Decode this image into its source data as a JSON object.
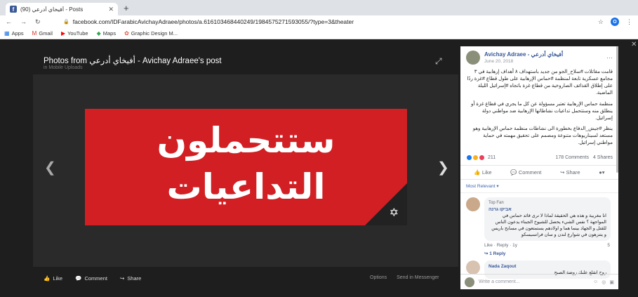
{
  "browser": {
    "tab_title": "(90) أفيخاي أدرعي - Posts",
    "tab_prefix": "...aee",
    "url": "facebook.com/IDFarabicAvichayAdraee/photos/a.616103468440249/1984575271593055/?type=3&theater",
    "bookmarks": [
      "Apps",
      "Gmail",
      "YouTube",
      "Maps",
      "Graphic Design M..."
    ],
    "profile_initial": "O"
  },
  "photo": {
    "title": "Photos from أفيخاي أدرعي - Avichay Adraee's post",
    "subtitle": "in Mobile Uploads",
    "line1": "ستتحملون",
    "line2": "التداعيات",
    "actions": {
      "like": "Like",
      "comment": "Comment",
      "share": "Share"
    },
    "options": "Options",
    "messenger": "Send in Messenger"
  },
  "post": {
    "author": "Avichay Adraee - أفيخاي أدرعي",
    "date": "June 20, 2018",
    "p1": "قامت مقاتلات #سلاح_الجو من جديد باستهداف ٨ أهداف إرهابية في ٣ مجامع عسكرية تابعة لمنظمة #حماس الإرهابية على طول قطاع #غزة ردًا على إطلاق القذائف الصاروخية من قطاع غزة باتجاه #إسرائيل الليلة الماضية.",
    "p2": "منظمة حماس الإرهابية تعتبر مسؤولة عن كل ما يجري في قطاع غزة أو ينطلق منه وستتحمل تداعيات نشاطاتها الإرهابية ضد مواطني دولة إسرائيل.",
    "p3": "ينظر #جيش_الدفاع بخطورة الى نشاطات منظمة حماس الإرهابية وهو مستعد لسيناريوهات متنوعة ومصمم على تحقيق مهمته في حماية مواطني إسرائيل.",
    "reaction_count": "211",
    "comments_count": "178 Comments",
    "shares_count": "4 Shares",
    "like": "Like",
    "comment": "Comment",
    "share": "Share",
    "most_relevant": "Most Relevant ▾"
  },
  "comment1": {
    "badge": "Top Fan",
    "name": "אביקו גרנה",
    "text": "انا مغربية و هذه هي الحقيقة لماذا لا نرى قائد حماس في المواجهة ؟ نفس الشيء يحصل للشيوخ الجبناء يدعون الناس للقتل و الجهاد بينما هما و اولادهم يستمتعون في مسابح باريس و يتنزهون في شوارع لندن و سان فرانسيسكو",
    "meta": "Like · Reply · 1y",
    "reacts": "5",
    "replies": "1 Reply"
  },
  "comment2": {
    "name": "Nada Zaqout",
    "text": "روح انقلع عليك روضة الصبح"
  },
  "compose": {
    "placeholder": "Write a comment..."
  }
}
